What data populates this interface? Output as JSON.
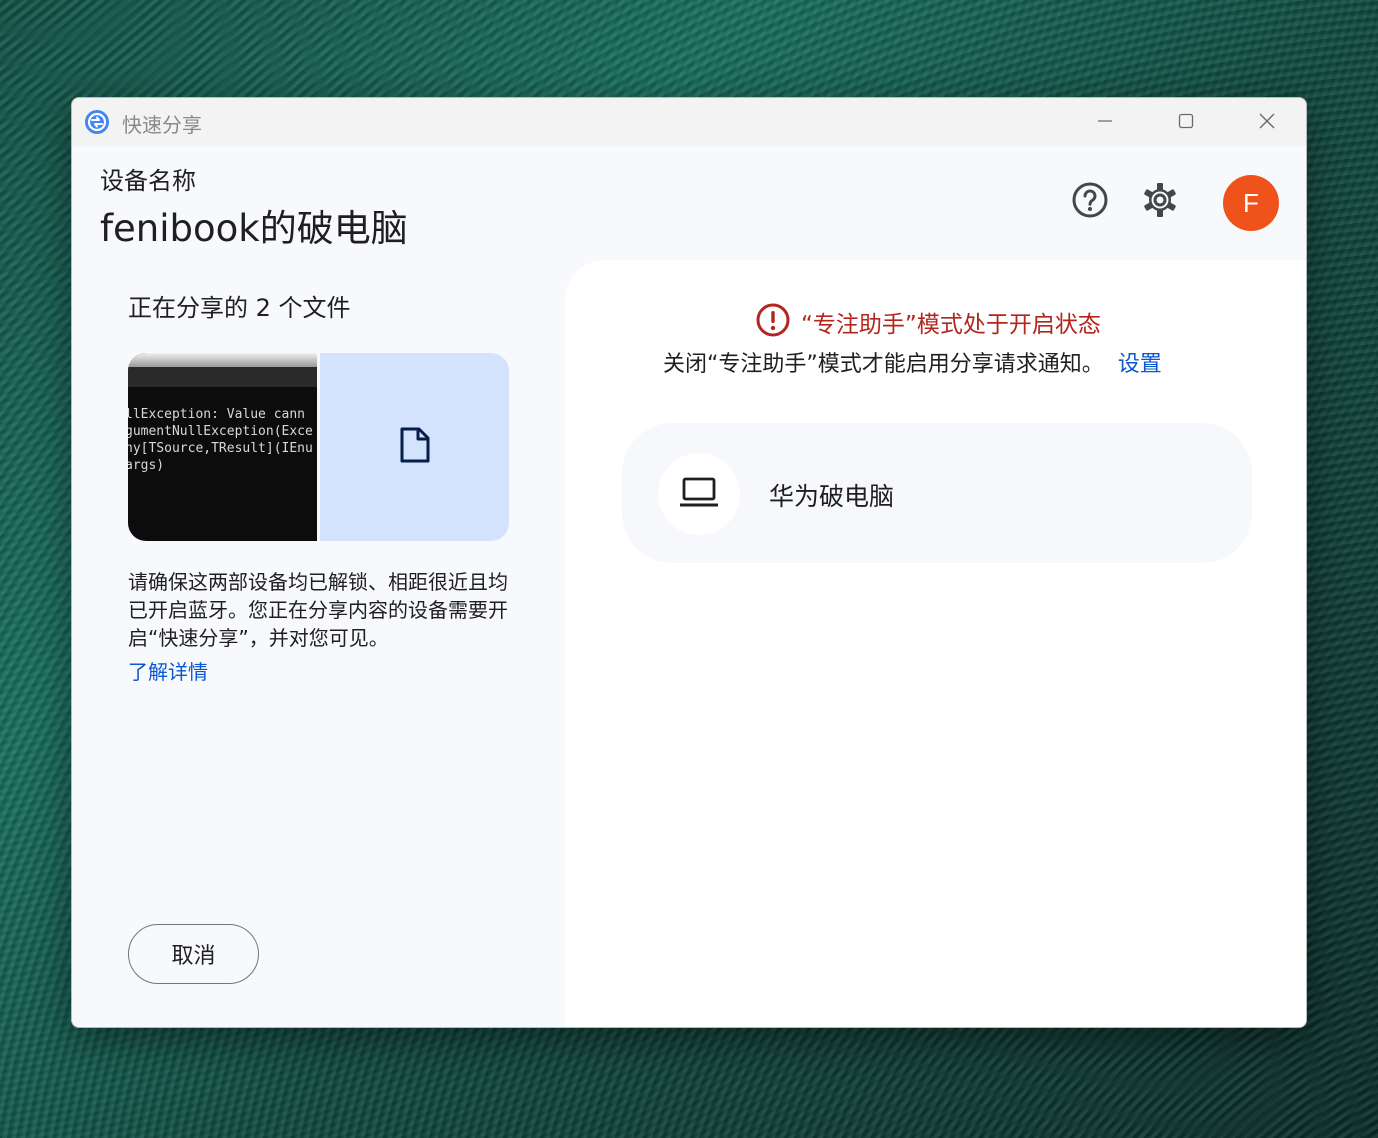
{
  "window": {
    "title": "快速分享",
    "app_icon": "quick-share-icon",
    "controls": {
      "minimize": "minimize-icon",
      "maximize": "maximize-icon",
      "close": "close-icon"
    }
  },
  "header": {
    "device_label": "设备名称",
    "device_name": "fenibook的破电脑",
    "help_icon": "help-icon",
    "settings_icon": "gear-icon",
    "avatar_letter": "F",
    "avatar_color": "#f0521c"
  },
  "left": {
    "sharing_title": "正在分享的 2 个文件",
    "console_lines": [
      "llException: Value cann",
      "gumentNullException(Exce",
      "ny[TSource,TResult](IEnu",
      "args)"
    ],
    "file_icon": "file-icon",
    "description": "请确保这两部设备均已解锁、相距很近且均已开启蓝牙。您正在分享内容的设备需要开启“快速分享”，并对您可见。",
    "learn_more": "了解详情",
    "cancel_label": "取消"
  },
  "right": {
    "warning_title": "“专注助手”模式处于开启状态",
    "warning_desc": "关闭“专注助手”模式才能启用分享请求通知。",
    "settings_link": "设置",
    "devices": [
      {
        "name": "华为破电脑",
        "icon": "laptop-icon"
      }
    ]
  },
  "colors": {
    "accent": "#0b57d0",
    "warning": "#b3261e",
    "file_tile": "#d3e3fd"
  }
}
